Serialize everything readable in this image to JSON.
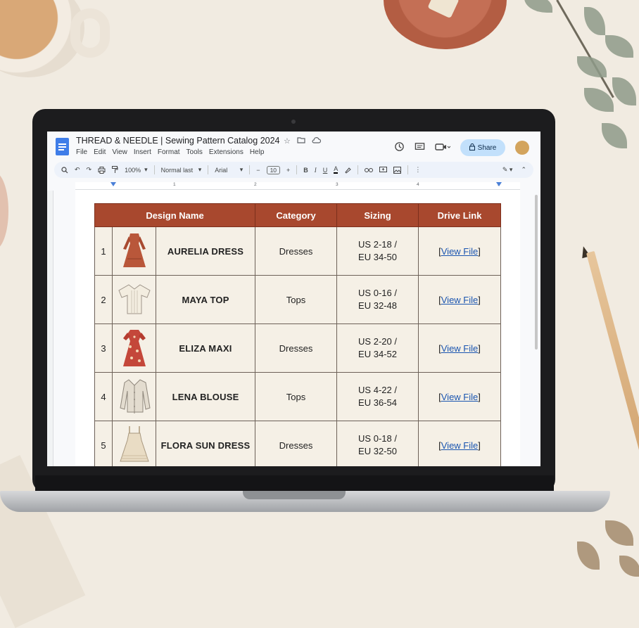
{
  "app": {
    "doc_title": "THREAD & NEEDLE | Sewing Pattern Catalog 2024",
    "menus": [
      "File",
      "Edit",
      "View",
      "Insert",
      "Format",
      "Tools",
      "Extensions",
      "Help"
    ],
    "share_label": "Share"
  },
  "toolbar": {
    "zoom": "100%",
    "style": "Normal last",
    "font": "Arial",
    "font_size": "10",
    "minus": "−",
    "plus": "+",
    "bold": "B",
    "italic": "I",
    "underline": "U",
    "text_color": "A"
  },
  "ruler": {
    "marks": [
      "1",
      "2",
      "3",
      "4",
      "5"
    ]
  },
  "table": {
    "headers": [
      "Design Name",
      "Category",
      "Sizing",
      "Drive Link"
    ],
    "rows": [
      {
        "num": "1",
        "name": "AURELIA DRESS",
        "category": "Dresses",
        "sizing_us": "US 2-18 /",
        "sizing_eu": "EU 34-50",
        "link": "View File",
        "thumb": "dress-rust"
      },
      {
        "num": "2",
        "name": "MAYA TOP",
        "category": "Tops",
        "sizing_us": "US 0-16 /",
        "sizing_eu": "EU 32-48",
        "link": "View File",
        "thumb": "top-cream"
      },
      {
        "num": "3",
        "name": "ELIZA MAXI",
        "category": "Dresses",
        "sizing_us": "US 2-20 /",
        "sizing_eu": "EU 34-52",
        "link": "View File",
        "thumb": "dress-floral"
      },
      {
        "num": "4",
        "name": "LENA BLOUSE",
        "category": "Tops",
        "sizing_us": "US 4-22 /",
        "sizing_eu": "EU 36-54",
        "link": "View File",
        "thumb": "blouse-beige"
      },
      {
        "num": "5",
        "name": "FLORA SUN DRESS",
        "category": "Dresses",
        "sizing_us": "US 0-18 /",
        "sizing_eu": "EU 32-50",
        "link": "View File",
        "thumb": "sundress-beige"
      }
    ]
  },
  "colors": {
    "header_bg": "#a8482e",
    "cell_bg": "#f5f0e6",
    "link": "#1a55b0",
    "share_bg": "#c2e0fb",
    "doc_icon": "#3f7de8"
  },
  "icons": [
    "docs-icon",
    "star-icon",
    "move-folder-icon",
    "cloud-status-icon",
    "history-icon",
    "comments-icon",
    "meet-icon",
    "lock-icon",
    "search-icon",
    "undo-icon",
    "redo-icon",
    "print-icon",
    "paint-format-icon",
    "highlight-icon",
    "link-icon",
    "comment-add-icon",
    "image-icon",
    "more-icon",
    "edit-mode-icon",
    "collapse-icon"
  ]
}
